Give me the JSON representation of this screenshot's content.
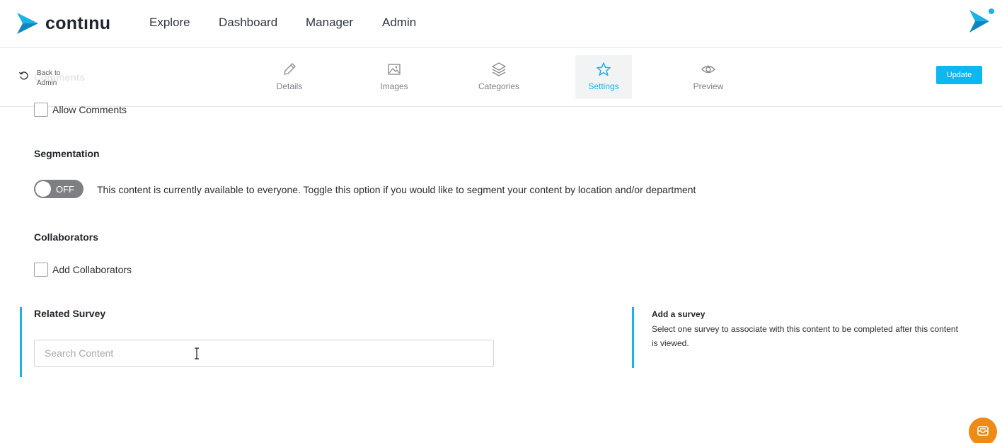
{
  "brand": {
    "name": "contınu",
    "accent": "#19b3e6"
  },
  "nav": {
    "items": [
      "Explore",
      "Dashboard",
      "Manager",
      "Admin"
    ]
  },
  "toolbar": {
    "back_label": "Back to Admin",
    "ghost_title": "Comments",
    "tabs": [
      {
        "label": "Details",
        "icon": "pencil-icon"
      },
      {
        "label": "Images",
        "icon": "image-icon"
      },
      {
        "label": "Categories",
        "icon": "layers-icon"
      },
      {
        "label": "Settings",
        "icon": "star-icon",
        "active": true
      },
      {
        "label": "Preview",
        "icon": "eye-icon"
      }
    ],
    "update_label": "Update",
    "update_color": "#0db8ef"
  },
  "comments": {
    "checkbox_label": "Allow Comments",
    "checked": false
  },
  "segmentation": {
    "title": "Segmentation",
    "toggle_state": "OFF",
    "description": "This content is currently available to everyone. Toggle this option if you would like to segment your content by location and/or department"
  },
  "collaborators": {
    "title": "Collaborators",
    "checkbox_label": "Add Collaborators",
    "checked": false
  },
  "related_survey": {
    "title": "Related Survey",
    "search_placeholder": "Search Content",
    "search_value": "",
    "help_title": "Add a survey",
    "help_text": "Select one survey to associate with this content to be completed after this content is viewed."
  },
  "chat": {
    "icon": "inbox-icon",
    "color": "#f08a17"
  }
}
